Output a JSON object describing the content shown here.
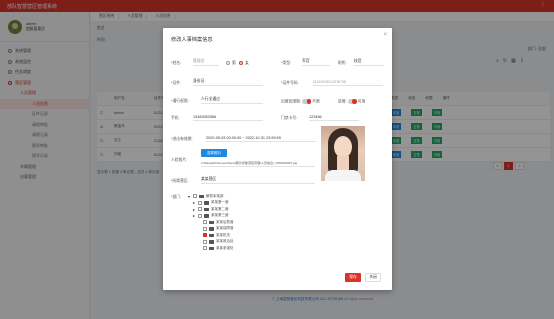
{
  "app": {
    "title": "部队智慧营区管理系统"
  },
  "user": {
    "name": "admin",
    "role": "超级管理员"
  },
  "sidebar": {
    "items": [
      {
        "label": "系统管理"
      },
      {
        "label": "系统监控"
      },
      {
        "label": "任务调度"
      },
      {
        "label": "营区管理"
      }
    ],
    "sub_items": [
      {
        "label": "人员管理"
      },
      {
        "label": "人员信息"
      },
      {
        "label": "证件记录"
      },
      {
        "label": "请假审批"
      },
      {
        "label": "请假记录"
      },
      {
        "label": "随军审批"
      },
      {
        "label": "随军记录"
      }
    ],
    "tail_items": [
      {
        "label": "车辆管理"
      },
      {
        "label": "访客管理"
      }
    ]
  },
  "background": {
    "crumbs": [
      "营区系统",
      "人员管理",
      "人员信息"
    ],
    "filter_labels": [
      "姓名:",
      "时间:"
    ],
    "dept_label": "部门:",
    "dept_value": "全部",
    "table_headers": [
      "",
      "用户名",
      "证件号"
    ],
    "table_rows": [
      {
        "name": "admin",
        "id": "512130190001"
      },
      {
        "name": "蔡金华",
        "id": "512130190001"
      },
      {
        "name": "长江",
        "id": "213012019001"
      },
      {
        "name": "刘某",
        "id": "512130190001"
      }
    ],
    "right_headers": [
      "类型",
      "状态",
      "权限",
      "操作"
    ],
    "tags": [
      "军官",
      "正常",
      "可用"
    ],
    "total_text": "显示第 1 到第 4 条记录，总共 4 条记录",
    "pager": [
      "<",
      "1",
      ">"
    ],
    "footer_prefix": "©",
    "footer_link": "上海智慧营区科技有限公司 021-70726155",
    "footer_suffix": "All rights reserved"
  },
  "modal": {
    "title": "修改人事档案信息",
    "close": "×",
    "fields": {
      "name_label": "*姓名:",
      "name_value": "管理员",
      "gender_male": "男",
      "gender_female": "女",
      "type_label": "*类型:",
      "type_value": "军官",
      "rank_label": "职衔:",
      "rank_value": "校官",
      "cert_label": "*证件:",
      "cert_value": "身份证",
      "cert_no_label": "*证件号码:",
      "cert_no_value": "512130190112190738",
      "pass_label": "*通行权限:",
      "pass_value": "人行全通过",
      "out_label": "出营区限制:",
      "out_value": "不限",
      "in_label": "进营:",
      "in_value": "可用",
      "phone_label": "手机:",
      "phone_value": "13482552566",
      "door_label": "门禁卡号:",
      "door_value": "123456",
      "valid_label": "*进出有效期:",
      "valid_value": "2020-05-03 00:00:00 ~ 2022-10-31 23:59:59",
      "face_label": "人脸照片:",
      "face_button": "选择照片",
      "face_path": "c:\\fakepath\\Tencent\\Face\\部队管理\\营区管理\\人员信息\\_1594691827.jpg",
      "camp_label": "*所属营区:",
      "camp_value": "某某营区",
      "dept_label": "*部门:"
    },
    "tree": [
      {
        "label": "解放军某部",
        "level": 0,
        "checked": false
      },
      {
        "label": "某某第一营",
        "level": 1,
        "checked": false
      },
      {
        "label": "某某第二营",
        "level": 1,
        "checked": false
      },
      {
        "label": "某某第三营",
        "level": 1,
        "checked": false
      },
      {
        "label": "某某后勤营",
        "level": 1,
        "checked": false
      },
      {
        "label": "某某保障营",
        "level": 1,
        "checked": false
      },
      {
        "label": "某某机关",
        "level": 1,
        "checked": true
      },
      {
        "label": "某某政治处",
        "level": 1,
        "checked": false
      },
      {
        "label": "某某参谋处",
        "level": 1,
        "checked": false
      }
    ],
    "save": "保存",
    "cancel": "关闭"
  },
  "colors": {
    "brand": "#d9342b",
    "blue": "#1e88e5",
    "green": "#25a96a"
  }
}
